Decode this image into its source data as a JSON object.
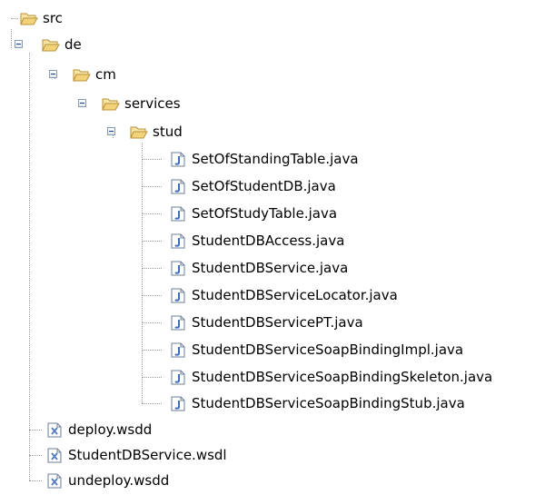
{
  "tree": {
    "root": {
      "label": "src",
      "icon": "folder-open-icon"
    },
    "packages": [
      {
        "label": "de",
        "icon": "folder-open-icon"
      },
      {
        "label": "cm",
        "icon": "folder-open-icon"
      },
      {
        "label": "services",
        "icon": "folder-open-icon"
      },
      {
        "label": "stud",
        "icon": "folder-open-icon"
      }
    ],
    "java_files": [
      "SetOfStandingTable.java",
      "SetOfStudentDB.java",
      "SetOfStudyTable.java",
      "StudentDBAccess.java",
      "StudentDBService.java",
      "StudentDBServiceLocator.java",
      "StudentDBServicePT.java",
      "StudentDBServiceSoapBindingImpl.java",
      "StudentDBServiceSoapBindingSkeleton.java",
      "StudentDBServiceSoapBindingStub.java"
    ],
    "xml_files": [
      "deploy.wsdd",
      "StudentDBService.wsdl",
      "undeploy.wsdd"
    ]
  },
  "colors": {
    "folder": "#f3d37a",
    "java_icon": "#3d6dbd",
    "xml_icon": "#5a7fbf",
    "connector": "#9a9a9a"
  }
}
